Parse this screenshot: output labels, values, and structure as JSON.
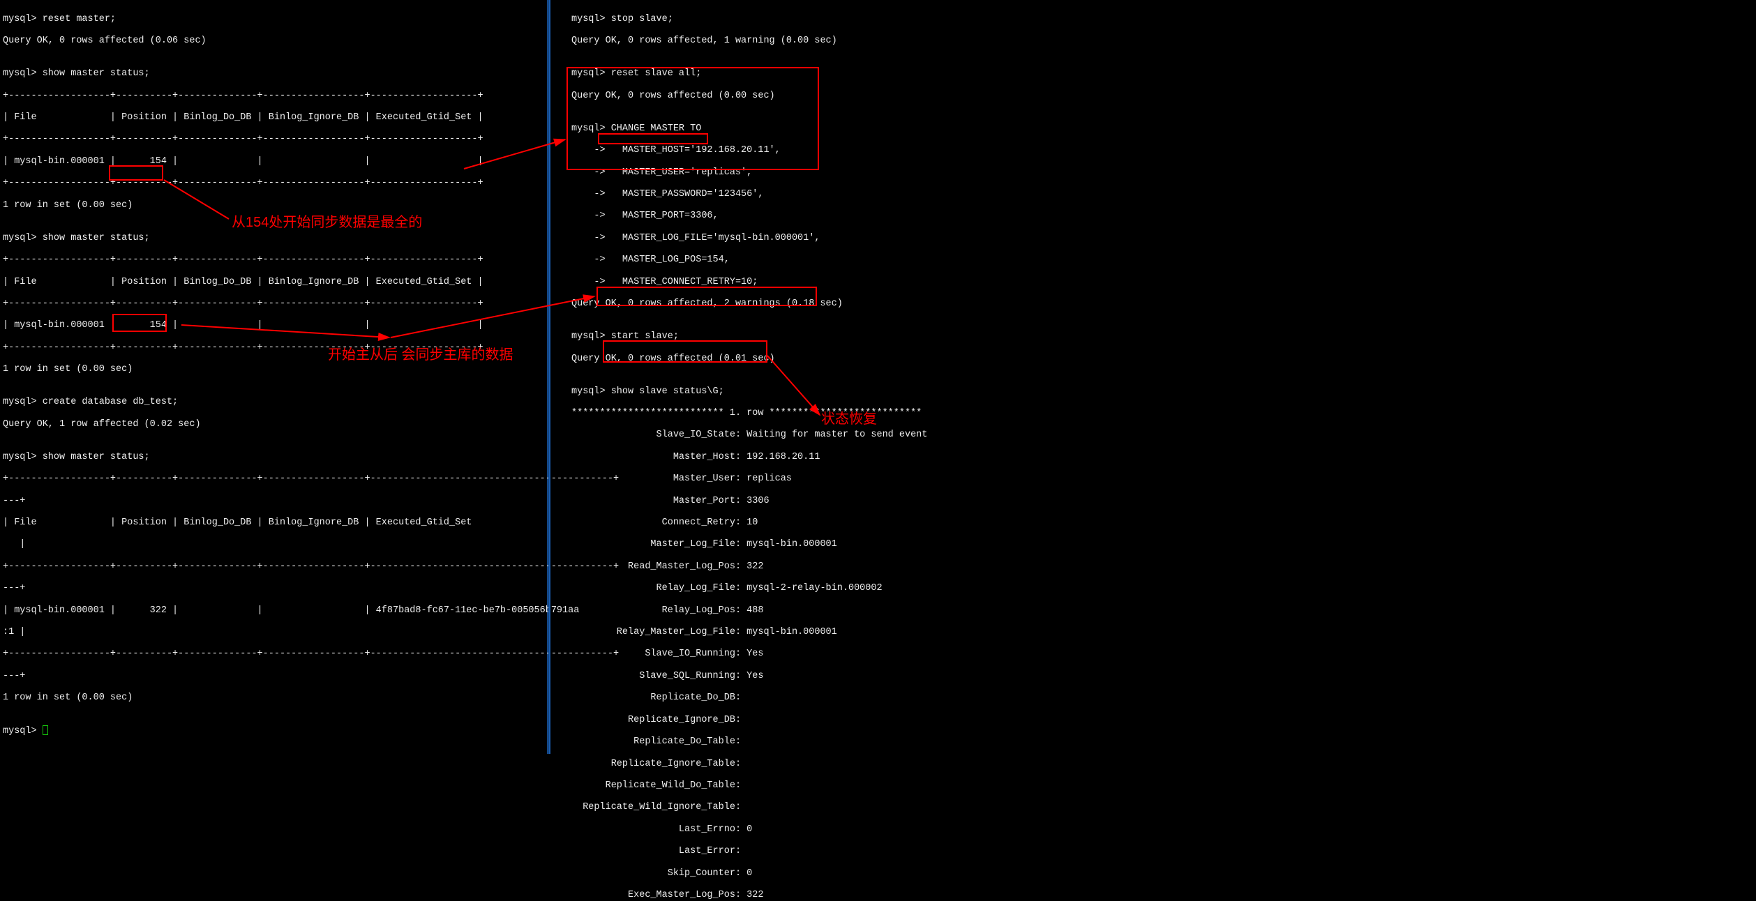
{
  "left": {
    "reset_cmd": "mysql> reset master;",
    "reset_resp": "Query OK, 0 rows affected (0.06 sec)",
    "show1_cmd": "mysql> show master status;",
    "hdr_sep": "+------------------+----------+--------------+------------------+-------------------+",
    "hdr": "| File             | Position | Binlog_Do_DB | Binlog_Ignore_DB | Executed_Gtid_Set |",
    "row1": "| mysql-bin.000001 |      154 |              |                  |                   |",
    "rowset": "1 row in set (0.00 sec)",
    "show2_cmd": "mysql> show master status;",
    "create_cmd": "mysql> create database db_test;",
    "create_resp": "Query OK, 1 row affected (0.02 sec)",
    "show3_cmd": "mysql> show master status;",
    "hdr3_sep": "+------------------+----------+--------------+------------------+-------------------------------------------+",
    "dash_tail": "---+",
    "hdr3_1": "| File             | Position | Binlog_Do_DB | Binlog_Ignore_DB | Executed_Gtid_Set",
    "hdr3_2": "   |",
    "row3_1": "| mysql-bin.000001 |      322 |              |                  | 4f87bad8-fc67-11ec-be7b-005056b791aa",
    "row3_2": ":1 |",
    "prompt": "mysql> ",
    "anno1": "从154处开始同步数据是最全的",
    "anno2": "开始主从后 会同步主库的数据"
  },
  "right": {
    "stop_cmd": "mysql> stop slave;",
    "stop_resp": "Query OK, 0 rows affected, 1 warning (0.00 sec)",
    "reset_cmd": "mysql> reset slave all;",
    "reset_resp": "Query OK, 0 rows affected (0.00 sec)",
    "chg0": "mysql> CHANGE MASTER TO",
    "chg1": "    ->   MASTER_HOST='192.168.20.11',",
    "chg2": "    ->   MASTER_USER='replicas',",
    "chg3": "    ->   MASTER_PASSWORD='123456',",
    "chg4": "    ->   MASTER_PORT=3306,",
    "chg5": "    ->   MASTER_LOG_FILE='mysql-bin.000001',",
    "chg6": "    ->   MASTER_LOG_POS=154,",
    "chg7": "    ->   MASTER_CONNECT_RETRY=10;",
    "chg_resp": "Query OK, 0 rows affected, 2 warnings (0.18 sec)",
    "start_cmd": "mysql> start slave;",
    "start_resp": "Query OK, 0 rows affected (0.01 sec)",
    "status_cmd": "mysql> show slave status\\G;",
    "row_hdr": "*************************** 1. row ***************************",
    "s_io_state": "               Slave_IO_State: Waiting for master to send event",
    "m_host": "                  Master_Host: 192.168.20.11",
    "m_user": "                  Master_User: replicas",
    "m_port": "                  Master_Port: 3306",
    "c_retry": "                Connect_Retry: 10",
    "m_logf": "              Master_Log_File: mysql-bin.000001",
    "r_mpos": "          Read_Master_Log_Pos: 322",
    "r_logf": "               Relay_Log_File: mysql-2-relay-bin.000002",
    "r_lpos": "                Relay_Log_Pos: 488",
    "rm_logf": "        Relay_Master_Log_File: mysql-bin.000001",
    "s_io_run": "             Slave_IO_Running: Yes",
    "s_sql_run": "            Slave_SQL_Running: Yes",
    "rep_do": "              Replicate_Do_DB:",
    "rep_ig": "          Replicate_Ignore_DB:",
    "rep_dot": "           Replicate_Do_Table:",
    "rep_igt": "       Replicate_Ignore_Table:",
    "rep_wdt": "      Replicate_Wild_Do_Table:",
    "rep_wit": "  Replicate_Wild_Ignore_Table:",
    "last_errno": "                   Last_Errno: 0",
    "last_err": "                   Last_Error:",
    "skip_cnt": "                 Skip_Counter: 0",
    "exec_pos": "          Exec_Master_Log_Pos: 322",
    "anno3": "状态恢复"
  }
}
